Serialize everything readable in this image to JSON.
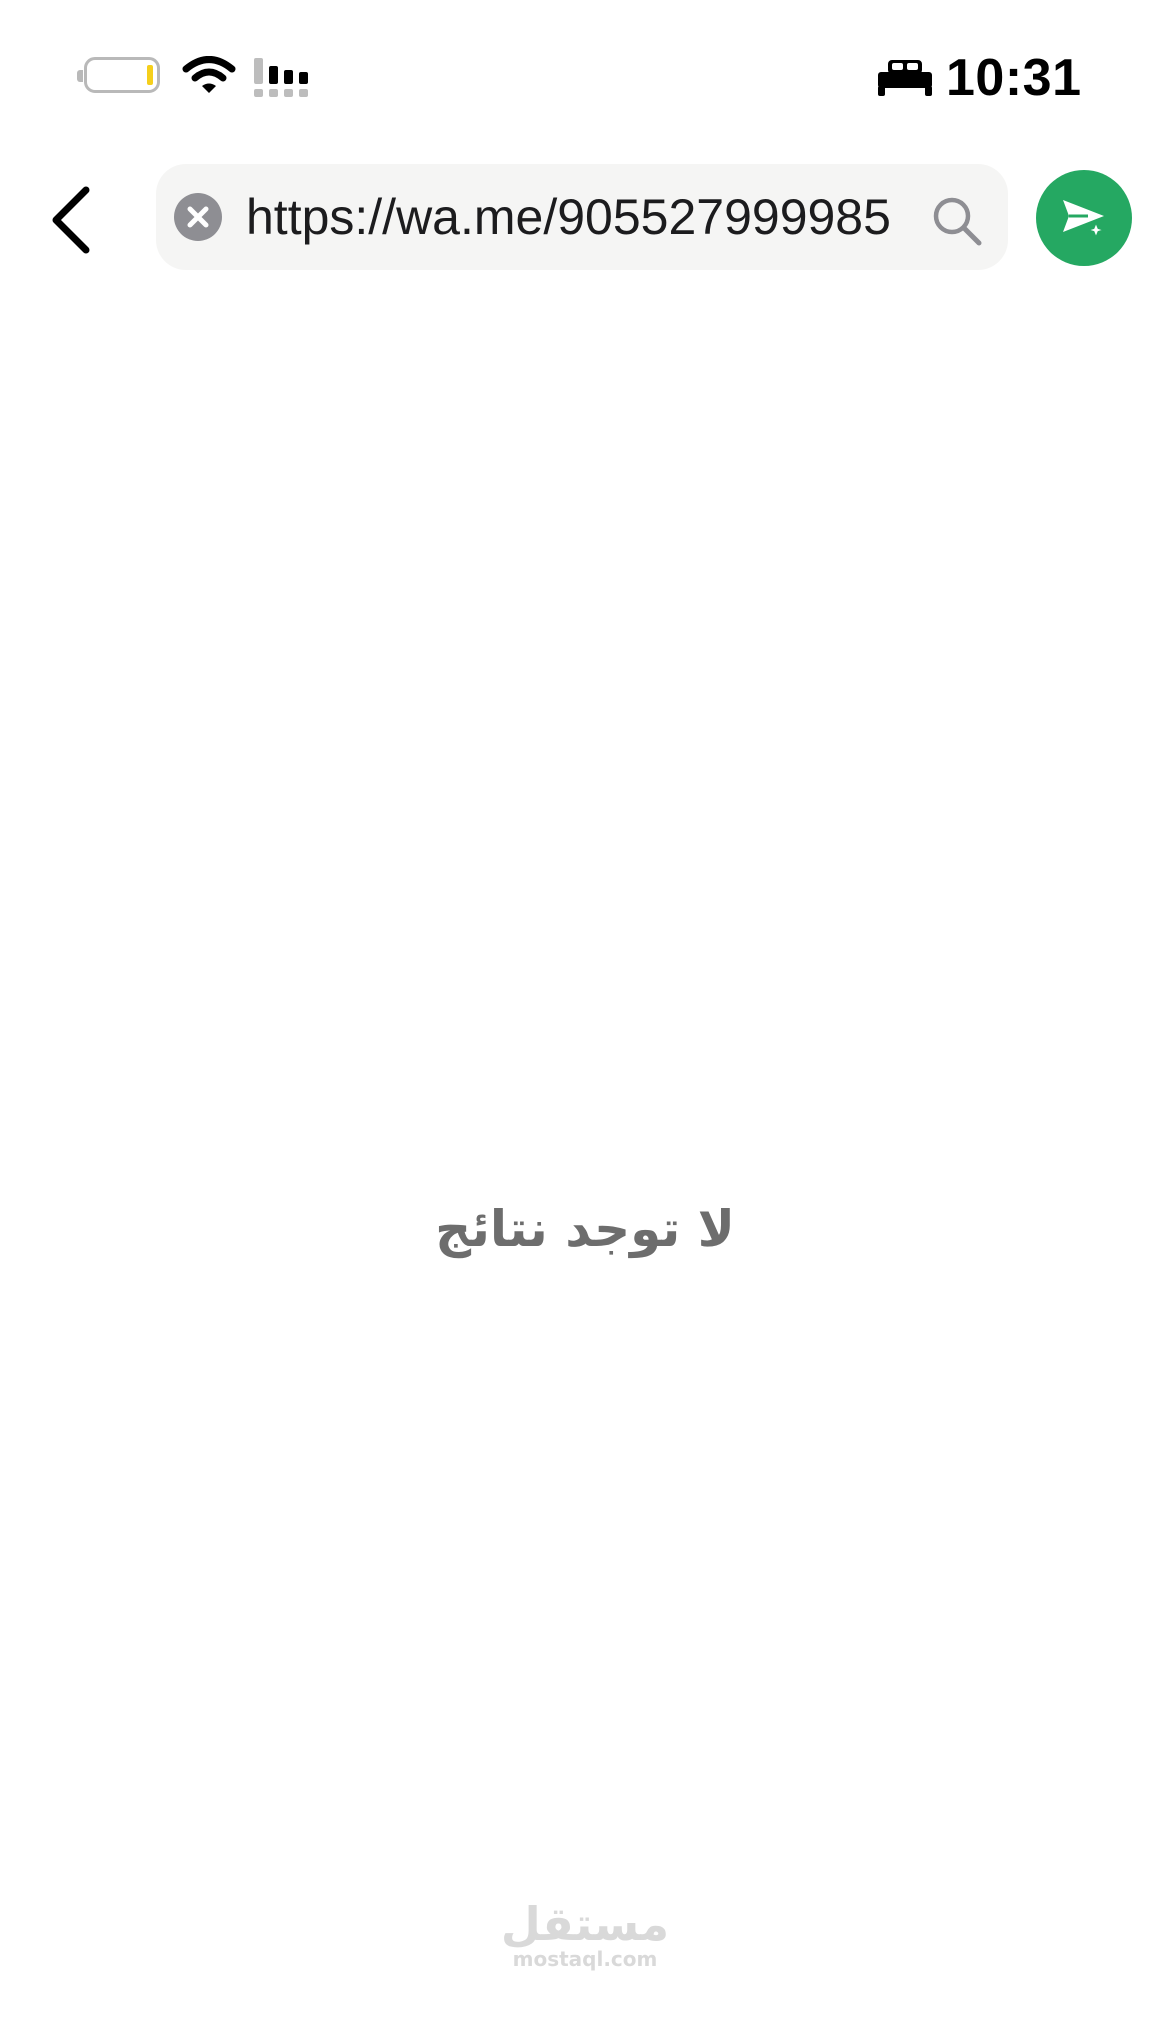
{
  "status_bar": {
    "time": "10:31",
    "battery_color": "#f5cf1b",
    "icons": [
      "battery-icon",
      "wifi-icon",
      "cellular-signal-icon",
      "sleep-focus-bed-icon"
    ]
  },
  "search": {
    "value": "https://wa.me/905527999985",
    "icons": [
      "clear-icon",
      "search-icon"
    ]
  },
  "header": {
    "back_icon": "chevron-left-icon",
    "send_icon": "send-sparkle-icon",
    "send_color": "#25a862"
  },
  "results": {
    "empty_message": "لا توجد نتائج"
  },
  "watermark": {
    "arabic": "مستقل",
    "latin": "mostaql.com"
  }
}
